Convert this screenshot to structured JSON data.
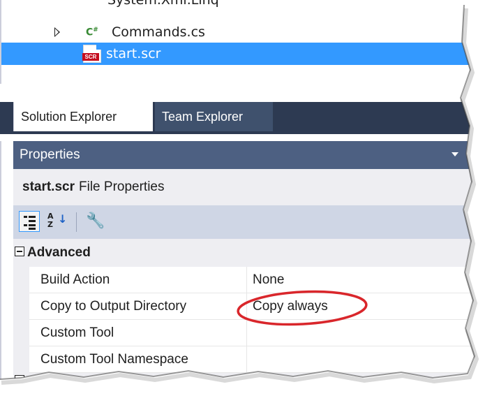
{
  "solution_tree": {
    "partial_item_label": "System.Xml.Linq",
    "items": [
      {
        "label": "Commands.cs",
        "icon": "csharp-file-icon",
        "icon_text": "C#",
        "expandable": true
      },
      {
        "label": "start.scr",
        "icon": "scr-file-icon",
        "icon_text": "SCR",
        "selected": true
      }
    ]
  },
  "tabs": [
    {
      "label": "Solution Explorer",
      "active": true
    },
    {
      "label": "Team Explorer",
      "active": false
    }
  ],
  "properties_panel": {
    "title": "Properties",
    "dropdown_icon": "dropdown-arrow-icon",
    "pin_icon": "pin-icon",
    "pin_glyph": "ꟼ",
    "object_name": "start.scr",
    "object_type": "File Properties",
    "toolbar": [
      {
        "icon": "categorized-icon",
        "active": true
      },
      {
        "icon": "alphabetical-icon",
        "text": "A\nZ"
      },
      {
        "icon": "property-pages-wrench-icon",
        "disabled": true
      }
    ],
    "category": "Advanced",
    "rows": [
      {
        "name": "Build Action",
        "value": "None"
      },
      {
        "name": "Copy to Output Directory",
        "value": "Copy always",
        "highlighted": true
      },
      {
        "name": "Custom Tool",
        "value": ""
      },
      {
        "name": "Custom Tool Namespace",
        "value": ""
      }
    ]
  },
  "colors": {
    "selection": "#3399ff",
    "tab_strip": "#2d3a52",
    "title_bar": "#4d6082",
    "highlight_ellipse": "#d9262b"
  }
}
